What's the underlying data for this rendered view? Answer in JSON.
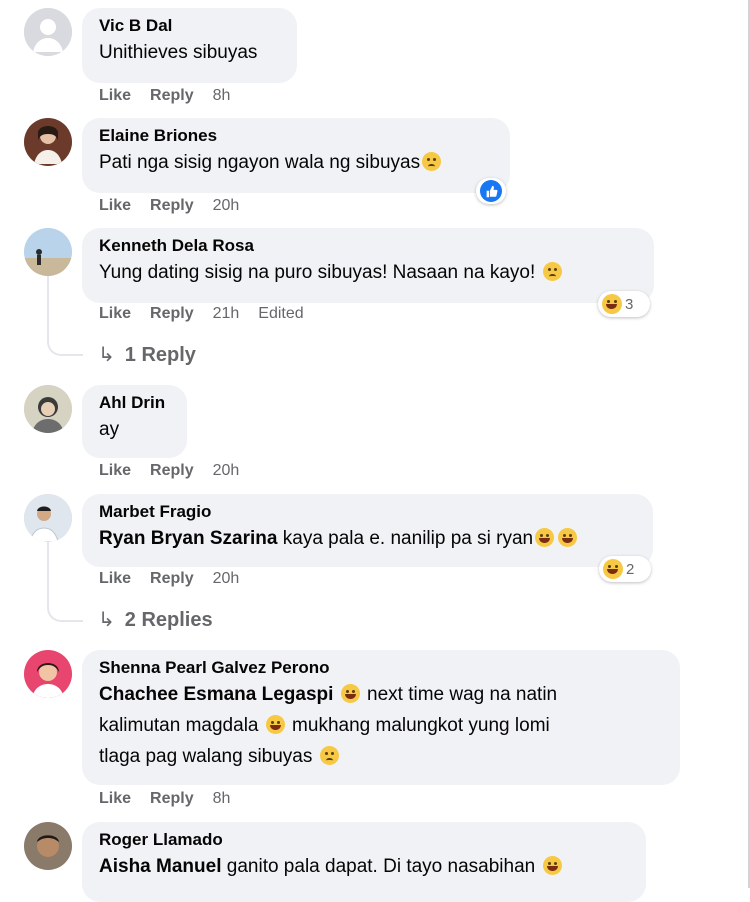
{
  "labels": {
    "like": "Like",
    "reply": "Reply"
  },
  "colors": {
    "bubble": "#f0f2f5",
    "meta_text": "#65676b",
    "like_blue": "#1877f2"
  },
  "comments": [
    {
      "author": "Vic B Dal",
      "text": "Unithieves sibuyas",
      "time": "8h",
      "avatar_icon": "default-avatar-icon"
    },
    {
      "author": "Elaine Briones",
      "text": "Pati nga sisig ngayon wala ng sibuyas",
      "time": "20h",
      "avatar_icon": "profile-photo",
      "reactions": {
        "types": [
          "like"
        ]
      }
    },
    {
      "author": "Kenneth Dela Rosa",
      "text": "Yung dating sisig na puro sibuyas! Nasaan na kayo!",
      "time": "21h",
      "edited": "Edited",
      "reactions": {
        "types": [
          "haha"
        ],
        "count": "3"
      },
      "replies": "1 Reply"
    },
    {
      "author": "Ahl Drin",
      "text": "ay",
      "time": "20h"
    },
    {
      "author": "Marbet Fragio",
      "mention": "Ryan Bryan Szarina",
      "text": "kaya pala e. nanilip pa si ryan",
      "time": "20h",
      "reactions": {
        "types": [
          "haha"
        ],
        "count": "2"
      },
      "replies": "2 Replies"
    },
    {
      "author": "Shenna Pearl Galvez Perono",
      "mention": "Chachee Esmana Legaspi",
      "lines": [
        "next time wag na natin",
        "kalimutan magdala",
        "mukhang malungkot yung lomi",
        "tlaga pag walang sibuyas"
      ],
      "time": "8h"
    },
    {
      "author": "Roger Llamado",
      "mention": "Aisha Manuel",
      "text": "ganito pala dapat. Di tayo nasabihan"
    }
  ]
}
